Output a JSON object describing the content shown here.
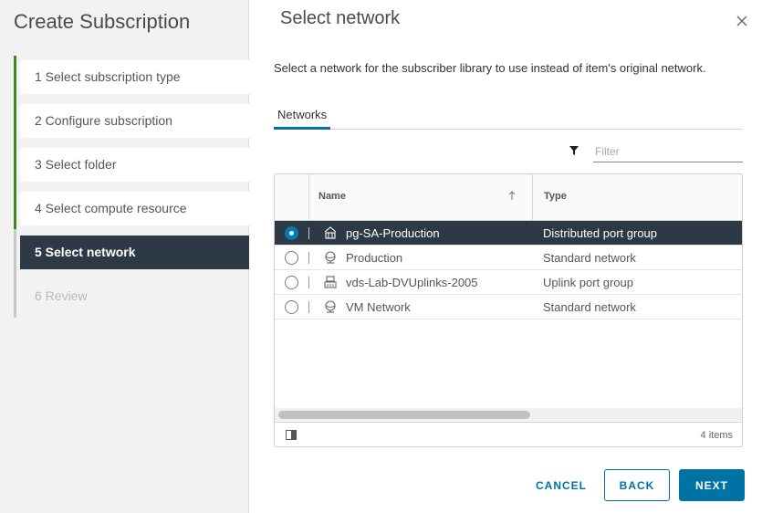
{
  "wizard": {
    "title": "Create Subscription",
    "steps": [
      {
        "label": "1  Select subscription type",
        "state": "done"
      },
      {
        "label": "2  Configure subscription",
        "state": "done"
      },
      {
        "label": "3  Select folder",
        "state": "done"
      },
      {
        "label": "4  Select compute resource",
        "state": "done"
      },
      {
        "label": "5  Select network",
        "state": "active"
      },
      {
        "label": "6  Review",
        "state": "disabled"
      }
    ]
  },
  "page": {
    "title": "Select network",
    "description": "Select a network for the subscriber library to use instead of item's original network.",
    "tab": "Networks",
    "filter_placeholder": "Filter"
  },
  "grid": {
    "columns": {
      "name": "Name",
      "type": "Type"
    },
    "rows": [
      {
        "name": "pg-SA-Production",
        "type": "Distributed port group",
        "icon": "distributed-port-group-icon",
        "selected": true
      },
      {
        "name": "Production",
        "type": "Standard network",
        "icon": "standard-network-icon",
        "selected": false
      },
      {
        "name": "vds-Lab-DVUplinks-2005",
        "type": "Uplink port group",
        "icon": "uplink-port-group-icon",
        "selected": false
      },
      {
        "name": "VM Network",
        "type": "Standard network",
        "icon": "standard-network-icon",
        "selected": false
      }
    ],
    "footer_count": "4 items"
  },
  "buttons": {
    "cancel": "CANCEL",
    "back": "BACK",
    "next": "NEXT"
  },
  "colors": {
    "accent": "#0072a3",
    "selected_row": "#2d3a45",
    "progress_bar": "#3d8b1f",
    "radio_checked": "#0079b8"
  }
}
